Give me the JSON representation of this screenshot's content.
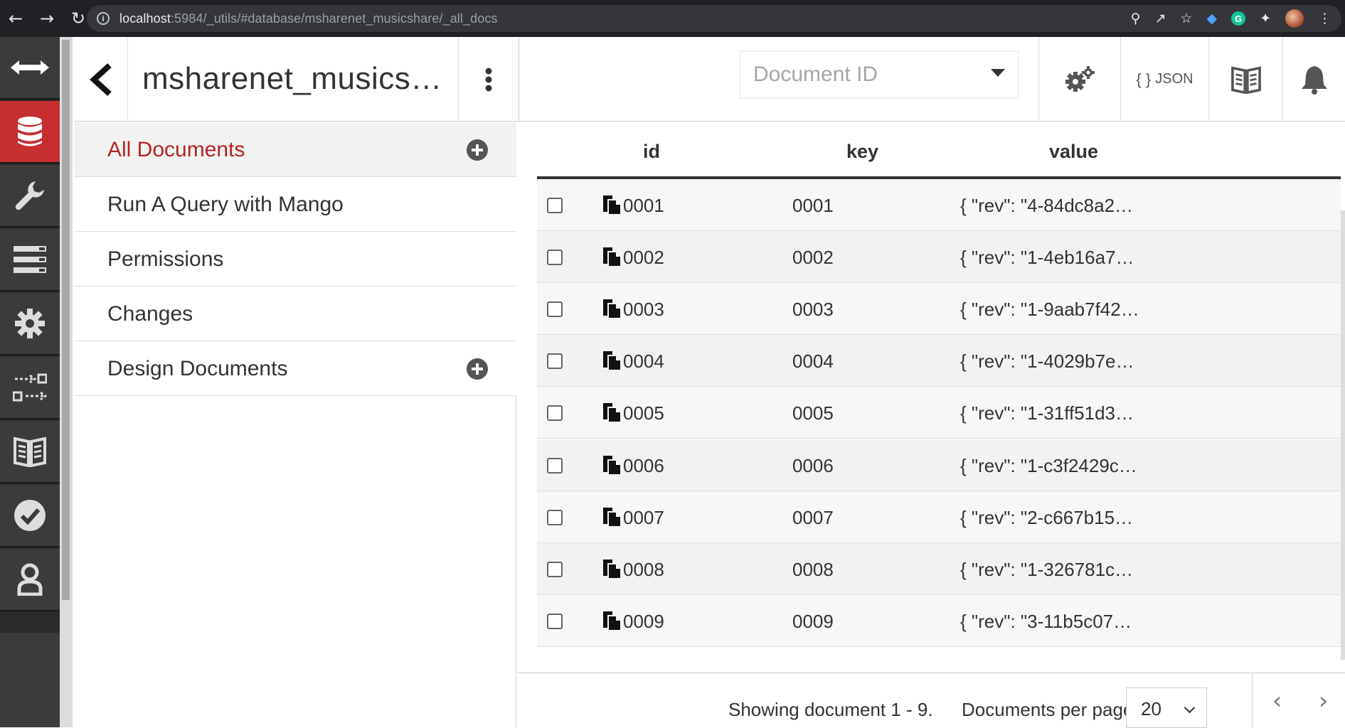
{
  "browser": {
    "url_host": "localhost",
    "url_rest": ":5984/_utils/#database/msharenet_musicshare/_all_docs"
  },
  "header": {
    "db_title": "msharenet_musics…",
    "docid_placeholder": "Document ID",
    "json_label": "JSON",
    "json_braces": "{ }"
  },
  "sidebar": {
    "items": [
      {
        "label": "All Documents",
        "active": true,
        "has_add": true
      },
      {
        "label": "Run A Query with Mango"
      },
      {
        "label": "Permissions"
      },
      {
        "label": "Changes"
      },
      {
        "label": "Design Documents",
        "has_add": true
      }
    ]
  },
  "table": {
    "columns": [
      "id",
      "key",
      "value"
    ],
    "rows": [
      {
        "id": "0001",
        "key": "0001",
        "value": "{ \"rev\": \"4-84dc8a2…"
      },
      {
        "id": "0002",
        "key": "0002",
        "value": "{ \"rev\": \"1-4eb16a7…"
      },
      {
        "id": "0003",
        "key": "0003",
        "value": "{ \"rev\": \"1-9aab7f42…"
      },
      {
        "id": "0004",
        "key": "0004",
        "value": "{ \"rev\": \"1-4029b7e…"
      },
      {
        "id": "0005",
        "key": "0005",
        "value": "{ \"rev\": \"1-31ff51d3…"
      },
      {
        "id": "0006",
        "key": "0006",
        "value": "{ \"rev\": \"1-c3f2429c…"
      },
      {
        "id": "0007",
        "key": "0007",
        "value": "{ \"rev\": \"2-c667b15…"
      },
      {
        "id": "0008",
        "key": "0008",
        "value": "{ \"rev\": \"1-326781c…"
      },
      {
        "id": "0009",
        "key": "0009",
        "value": "{ \"rev\": \"3-11b5c07…"
      }
    ]
  },
  "footer": {
    "showing": "Showing document 1 - 9.",
    "per_page_label": "Documents per page:",
    "per_page_value": "20"
  },
  "colors": {
    "accent_red": "#c52f2f",
    "rail_bg": "#2a2a2a",
    "active_text": "#b32424"
  },
  "icons": {
    "rail": [
      "collapse-arrows-icon",
      "database-icon",
      "wrench-icon",
      "list-icon",
      "gear-icon",
      "replication-icon",
      "docs-book-icon",
      "verify-check-icon",
      "user-icon"
    ]
  }
}
